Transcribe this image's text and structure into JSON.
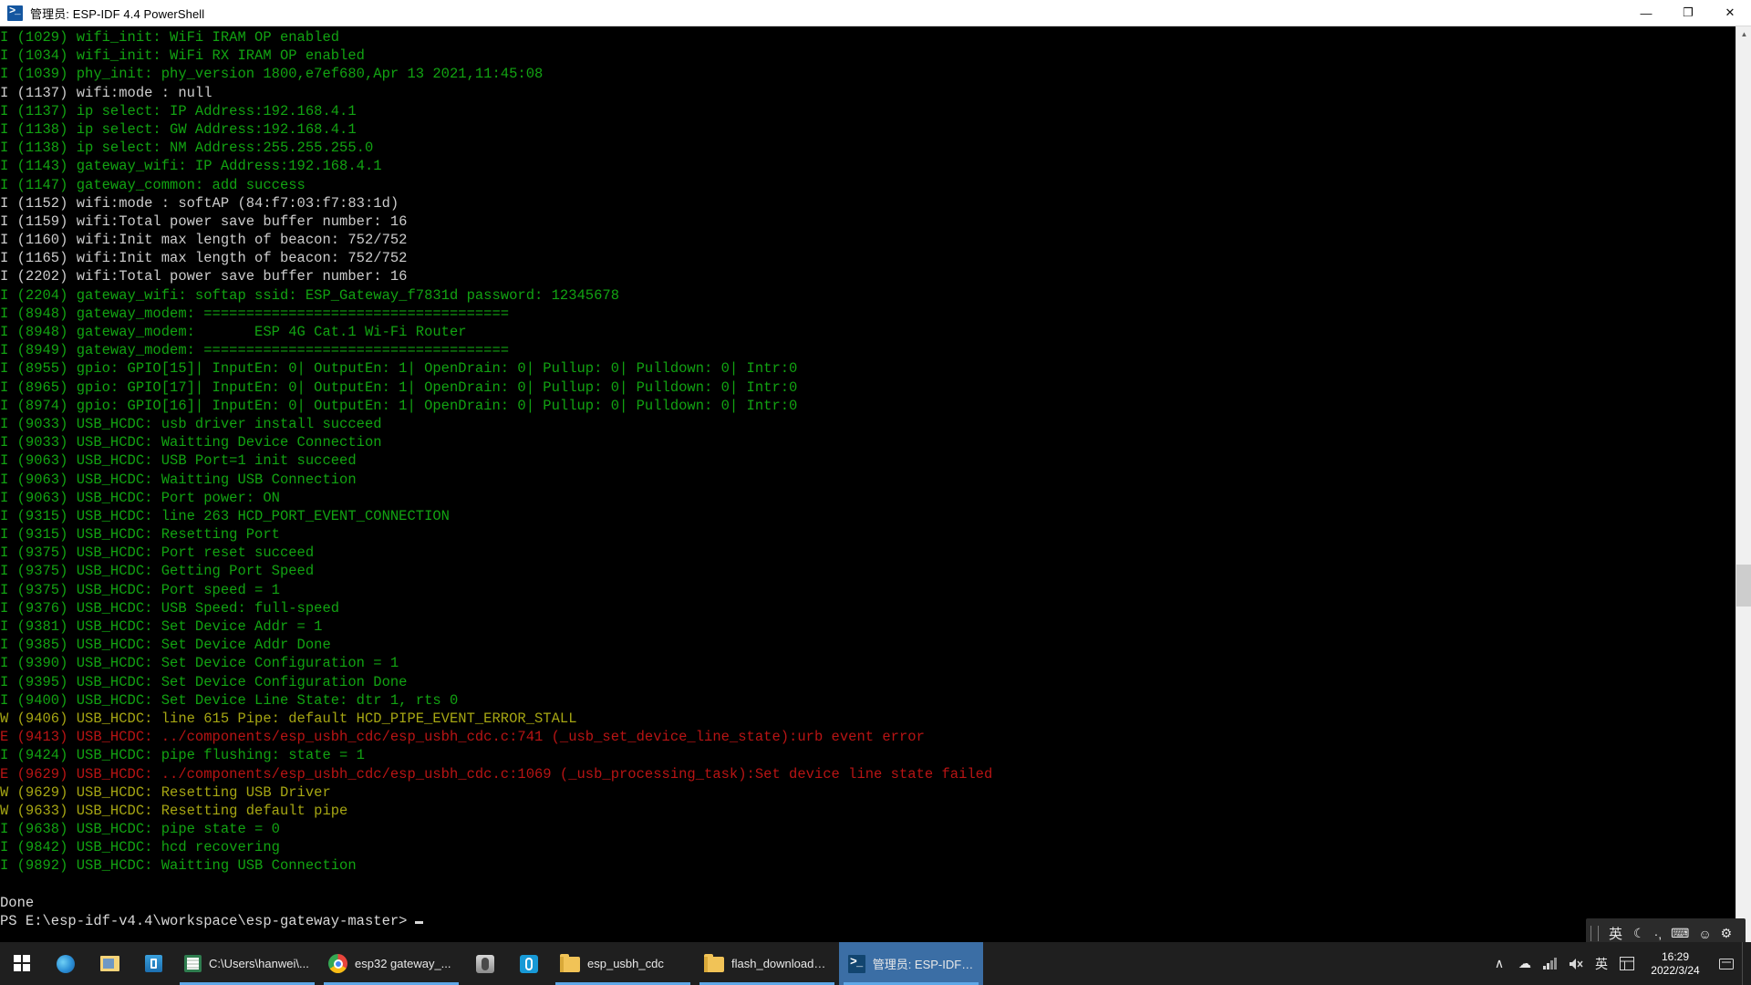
{
  "window": {
    "title": "管理员: ESP-IDF 4.4 PowerShell",
    "app_icon": "powershell-icon",
    "minimize_label": "—",
    "maximize_label": "❐",
    "close_label": "✕"
  },
  "terminal": {
    "background": "#000000",
    "colors": {
      "info": "#12a312",
      "warn": "#a6a613",
      "error": "#b81414",
      "white": "#cccccc"
    },
    "lines": [
      {
        "level": "I",
        "color": "info",
        "text": "I (1029) wifi_init: WiFi IRAM OP enabled"
      },
      {
        "level": "I",
        "color": "info",
        "text": "I (1034) wifi_init: WiFi RX IRAM OP enabled"
      },
      {
        "level": "I",
        "color": "info",
        "text": "I (1039) phy_init: phy_version 1800,e7ef680,Apr 13 2021,11:45:08"
      },
      {
        "level": "I",
        "color": "white",
        "text": "I (1137) wifi:mode : null"
      },
      {
        "level": "I",
        "color": "info",
        "text": "I (1137) ip select: IP Address:192.168.4.1"
      },
      {
        "level": "I",
        "color": "info",
        "text": "I (1138) ip select: GW Address:192.168.4.1"
      },
      {
        "level": "I",
        "color": "info",
        "text": "I (1138) ip select: NM Address:255.255.255.0"
      },
      {
        "level": "I",
        "color": "info",
        "text": "I (1143) gateway_wifi: IP Address:192.168.4.1"
      },
      {
        "level": "I",
        "color": "info",
        "text": "I (1147) gateway_common: add success"
      },
      {
        "level": "I",
        "color": "white",
        "text": "I (1152) wifi:mode : softAP (84:f7:03:f7:83:1d)"
      },
      {
        "level": "I",
        "color": "white",
        "text": "I (1159) wifi:Total power save buffer number: 16"
      },
      {
        "level": "I",
        "color": "white",
        "text": "I (1160) wifi:Init max length of beacon: 752/752"
      },
      {
        "level": "I",
        "color": "white",
        "text": "I (1165) wifi:Init max length of beacon: 752/752"
      },
      {
        "level": "I",
        "color": "white",
        "text": "I (2202) wifi:Total power save buffer number: 16"
      },
      {
        "level": "I",
        "color": "info",
        "text": "I (2204) gateway_wifi: softap ssid: ESP_Gateway_f7831d password: 12345678"
      },
      {
        "level": "I",
        "color": "info",
        "text": "I (8948) gateway_modem: ===================================="
      },
      {
        "level": "I",
        "color": "info",
        "text": "I (8948) gateway_modem:       ESP 4G Cat.1 Wi-Fi Router"
      },
      {
        "level": "I",
        "color": "info",
        "text": "I (8949) gateway_modem: ===================================="
      },
      {
        "level": "I",
        "color": "info",
        "text": "I (8955) gpio: GPIO[15]| InputEn: 0| OutputEn: 1| OpenDrain: 0| Pullup: 0| Pulldown: 0| Intr:0"
      },
      {
        "level": "I",
        "color": "info",
        "text": "I (8965) gpio: GPIO[17]| InputEn: 0| OutputEn: 1| OpenDrain: 0| Pullup: 0| Pulldown: 0| Intr:0"
      },
      {
        "level": "I",
        "color": "info",
        "text": "I (8974) gpio: GPIO[16]| InputEn: 0| OutputEn: 1| OpenDrain: 0| Pullup: 0| Pulldown: 0| Intr:0"
      },
      {
        "level": "I",
        "color": "info",
        "text": "I (9033) USB_HCDC: usb driver install succeed"
      },
      {
        "level": "I",
        "color": "info",
        "text": "I (9033) USB_HCDC: Waitting Device Connection"
      },
      {
        "level": "I",
        "color": "info",
        "text": "I (9063) USB_HCDC: USB Port=1 init succeed"
      },
      {
        "level": "I",
        "color": "info",
        "text": "I (9063) USB_HCDC: Waitting USB Connection"
      },
      {
        "level": "I",
        "color": "info",
        "text": "I (9063) USB_HCDC: Port power: ON"
      },
      {
        "level": "I",
        "color": "info",
        "text": "I (9315) USB_HCDC: line 263 HCD_PORT_EVENT_CONNECTION"
      },
      {
        "level": "I",
        "color": "info",
        "text": "I (9315) USB_HCDC: Resetting Port"
      },
      {
        "level": "I",
        "color": "info",
        "text": "I (9375) USB_HCDC: Port reset succeed"
      },
      {
        "level": "I",
        "color": "info",
        "text": "I (9375) USB_HCDC: Getting Port Speed"
      },
      {
        "level": "I",
        "color": "info",
        "text": "I (9375) USB_HCDC: Port speed = 1"
      },
      {
        "level": "I",
        "color": "info",
        "text": "I (9376) USB_HCDC: USB Speed: full-speed"
      },
      {
        "level": "I",
        "color": "info",
        "text": "I (9381) USB_HCDC: Set Device Addr = 1"
      },
      {
        "level": "I",
        "color": "info",
        "text": "I (9385) USB_HCDC: Set Device Addr Done"
      },
      {
        "level": "I",
        "color": "info",
        "text": "I (9390) USB_HCDC: Set Device Configuration = 1"
      },
      {
        "level": "I",
        "color": "info",
        "text": "I (9395) USB_HCDC: Set Device Configuration Done"
      },
      {
        "level": "I",
        "color": "info",
        "text": "I (9400) USB_HCDC: Set Device Line State: dtr 1, rts 0"
      },
      {
        "level": "W",
        "color": "warn",
        "text": "W (9406) USB_HCDC: line 615 Pipe: default HCD_PIPE_EVENT_ERROR_STALL"
      },
      {
        "level": "E",
        "color": "error",
        "text": "E (9413) USB_HCDC: ../components/esp_usbh_cdc/esp_usbh_cdc.c:741 (_usb_set_device_line_state):urb event error"
      },
      {
        "level": "I",
        "color": "info",
        "text": "I (9424) USB_HCDC: pipe flushing: state = 1"
      },
      {
        "level": "E",
        "color": "error",
        "text": "E (9629) USB_HCDC: ../components/esp_usbh_cdc/esp_usbh_cdc.c:1069 (_usb_processing_task):Set device line state failed"
      },
      {
        "level": "W",
        "color": "warn",
        "text": "W (9629) USB_HCDC: Resetting USB Driver"
      },
      {
        "level": "W",
        "color": "warn",
        "text": "W (9633) USB_HCDC: Resetting default pipe"
      },
      {
        "level": "I",
        "color": "info",
        "text": "I (9638) USB_HCDC: pipe state = 0"
      },
      {
        "level": "I",
        "color": "info",
        "text": "I (9842) USB_HCDC: hcd recovering"
      },
      {
        "level": "I",
        "color": "info",
        "text": "I (9892) USB_HCDC: Waitting USB Connection"
      },
      {
        "level": "",
        "color": "plain",
        "text": ""
      },
      {
        "level": "",
        "color": "plain",
        "text": "Done"
      }
    ],
    "prompt": "PS E:\\esp-idf-v4.4\\workspace\\esp-gateway-master>",
    "scrollbar": {
      "up_arrow": "▲",
      "down_arrow": "▼"
    }
  },
  "ime_bar": {
    "language": "英",
    "mode_icon": "moon-icon",
    "punctuation_icon": "punctuation-icon",
    "keyboard_icon": "keyboard-icon",
    "emoji_icon": "emoji-icon",
    "settings_icon": "gear-icon"
  },
  "taskbar": {
    "start_label": "start-button",
    "quick_launch": [
      {
        "name": "edge-icon",
        "icon": "ico-edge"
      },
      {
        "name": "file-explorer-icon",
        "icon": "ico-explorer"
      },
      {
        "name": "store-icon",
        "icon": "ico-store"
      }
    ],
    "buttons": [
      {
        "name": "task-notepad",
        "label": "C:\\Users\\hanwei\\...",
        "icon": "ico-notepad",
        "active": false,
        "open": true,
        "wide": true
      },
      {
        "name": "task-chrome",
        "label": "esp32 gateway_...",
        "icon": "ico-chrome",
        "active": false,
        "open": true,
        "wide": true
      },
      {
        "name": "task-gray-app",
        "label": "",
        "icon": "ico-gray",
        "active": false,
        "open": false,
        "wide": false
      },
      {
        "name": "task-blue-app",
        "label": "",
        "icon": "ico-blueapp",
        "active": false,
        "open": false,
        "wide": false
      },
      {
        "name": "task-folder-esp-usbh-cdc",
        "label": "esp_usbh_cdc",
        "icon": "ico-folder",
        "active": false,
        "open": true,
        "wide": true
      },
      {
        "name": "task-folder-flash-download",
        "label": "flash_download_t...",
        "icon": "ico-folder",
        "active": false,
        "open": true,
        "wide": true
      },
      {
        "name": "task-powershell",
        "label": "管理员: ESP-IDF 4...",
        "icon": "ico-ps",
        "active": true,
        "open": true,
        "wide": true
      }
    ],
    "tray": {
      "chevron_up": "∧",
      "cloud_icon": "☁",
      "network_icon": "network-icon",
      "volume_icon": "volume-mute-icon",
      "ime_label": "英",
      "ime_box_icon": "ime-box-icon",
      "time": "16:29",
      "date": "2022/3/24",
      "action_center_icon": "notification-icon"
    }
  }
}
